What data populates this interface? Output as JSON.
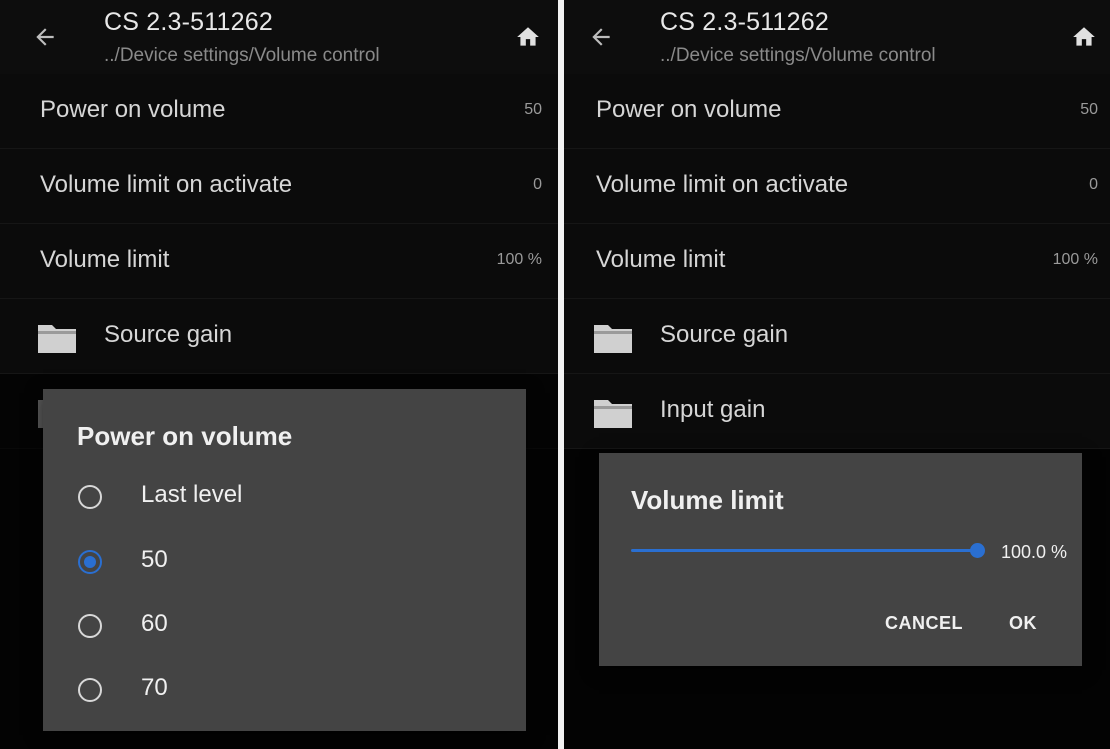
{
  "left": {
    "appbar": {
      "title": "CS 2.3-511262",
      "breadcrumb": "../Device settings/Volume control"
    },
    "rows": [
      {
        "label": "Power on volume",
        "value": "50"
      },
      {
        "label": "Volume limit on activate",
        "value": "0"
      },
      {
        "label": "Volume limit",
        "value": "100 %"
      }
    ],
    "folders": [
      {
        "label": "Source gain"
      }
    ],
    "dialog": {
      "title": "Power on volume",
      "options": [
        {
          "label": "Last level",
          "selected": false
        },
        {
          "label": "50",
          "selected": true
        },
        {
          "label": "60",
          "selected": false
        },
        {
          "label": "70",
          "selected": false
        }
      ]
    }
  },
  "right": {
    "appbar": {
      "title": "CS 2.3-511262",
      "breadcrumb": "../Device settings/Volume control"
    },
    "rows": [
      {
        "label": "Power on volume",
        "value": "50"
      },
      {
        "label": "Volume limit on activate",
        "value": "0"
      },
      {
        "label": "Volume limit",
        "value": "100 %"
      }
    ],
    "folders": [
      {
        "label": "Source gain"
      },
      {
        "label": "Input gain"
      }
    ],
    "dialog": {
      "title": "Volume limit",
      "slider_value_label": "100.0 %",
      "slider_fraction": 1.0,
      "cancel_label": "CANCEL",
      "ok_label": "OK"
    }
  },
  "colors": {
    "accent": "#2a6fd1",
    "dialog_bg": "#444444",
    "background": "#080808"
  }
}
